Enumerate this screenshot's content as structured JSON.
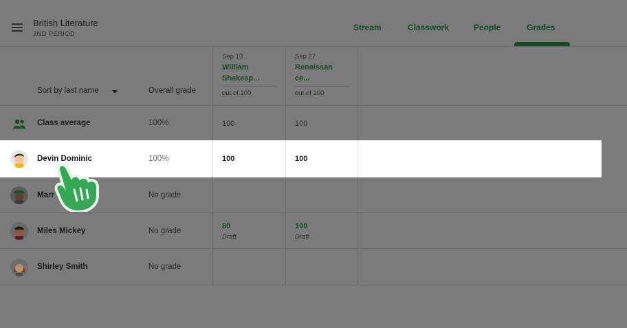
{
  "header": {
    "class_title": "British Literature",
    "class_subtitle": "2ND PERIOD",
    "tabs": [
      {
        "label": "Stream",
        "active": false
      },
      {
        "label": "Classwork",
        "active": false
      },
      {
        "label": "People",
        "active": false
      },
      {
        "label": "Grades",
        "active": true
      }
    ]
  },
  "table": {
    "sort_label": "Sort by last name",
    "overall_label": "Overall grade",
    "assignments": [
      {
        "date": "Sep 13",
        "title_line1": "William",
        "title_line2": "Shakesp...",
        "out_of": "out of 100"
      },
      {
        "date": "Sep 27",
        "title_line1": "Renaissan",
        "title_line2": "ce...",
        "out_of": "out of 100"
      }
    ],
    "class_average": {
      "label": "Class average",
      "overall": "100%",
      "scores": [
        "100",
        "100"
      ]
    },
    "students": [
      {
        "name": "Devin Dominic",
        "overall": "100%",
        "scores": [
          "100",
          "100"
        ],
        "drafts": [
          "",
          ""
        ],
        "highlighted": true
      },
      {
        "name": "Marr",
        "overall": "No grade",
        "scores": [
          "",
          ""
        ],
        "drafts": [
          "",
          ""
        ]
      },
      {
        "name": "Miles Mickey",
        "overall": "No grade",
        "scores": [
          "80",
          "100"
        ],
        "drafts": [
          "Draft",
          "Draft"
        ]
      },
      {
        "name": "Shirley Smith",
        "overall": "No grade",
        "scores": [
          "",
          ""
        ],
        "drafts": [
          "",
          ""
        ]
      }
    ]
  },
  "icons": {
    "menu": "hamburger-menu-icon",
    "sort_caret": "caret-down-icon",
    "class_average": "group-people-icon",
    "pointer": "hand-pointer-icon"
  },
  "colors": {
    "accent_green": "#1e8e3e",
    "overlay_gray": "#7b7b7b",
    "highlight_row": "#ffffff"
  }
}
